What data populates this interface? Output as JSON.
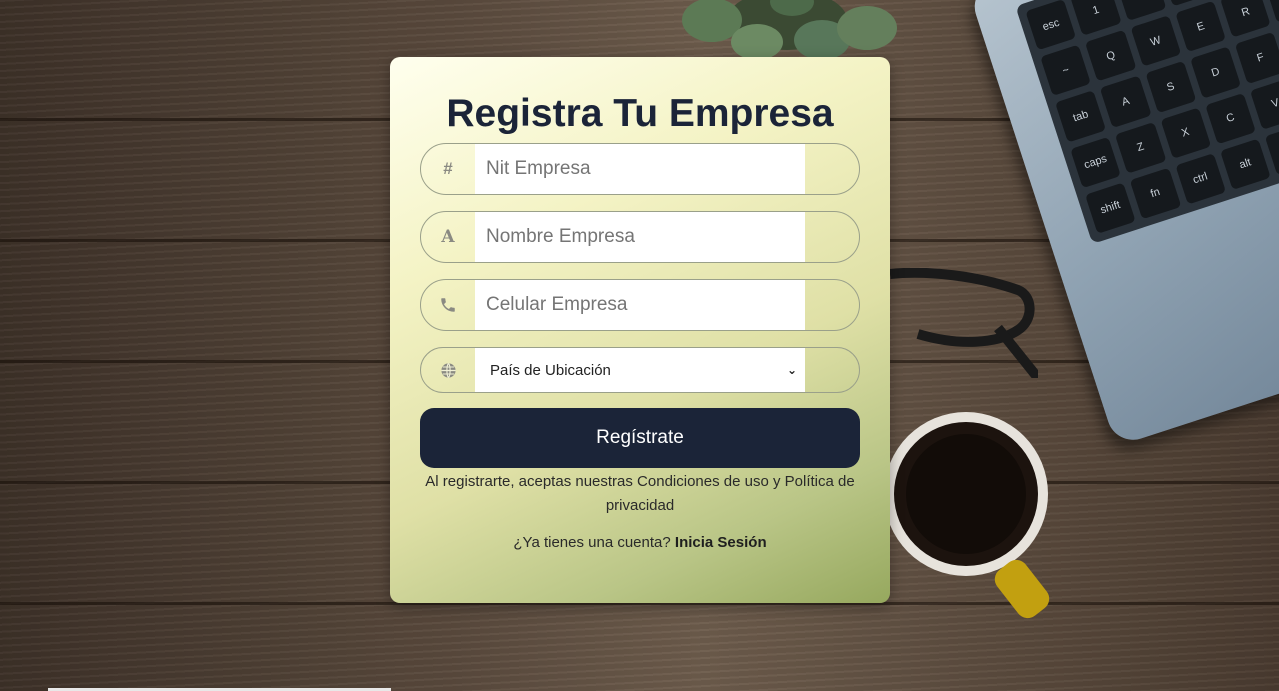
{
  "page": {
    "title": "Registra Tu Empresa"
  },
  "form": {
    "fields": [
      {
        "icon": "hash-icon",
        "glyph": "#",
        "placeholder": "Nit Empresa",
        "value": ""
      },
      {
        "icon": "letter-a-icon",
        "glyph": "A",
        "placeholder": "Nombre Empresa",
        "value": ""
      },
      {
        "icon": "phone-icon",
        "glyph": "☎",
        "placeholder": "Celular Empresa",
        "value": ""
      }
    ],
    "country": {
      "icon": "globe-icon",
      "selected": "País de Ubicación"
    },
    "submit_label": "Regístrate",
    "terms_text": "Al registrarte, aceptas nuestras Condiciones de uso y Política de privacidad",
    "login_prompt": "¿Ya tienes una cuenta?",
    "login_link": "Inicia Sesión"
  },
  "colors": {
    "primary": "#1b2438",
    "card_gradient_start": "#ffffee",
    "card_gradient_end": "#96a85e"
  }
}
